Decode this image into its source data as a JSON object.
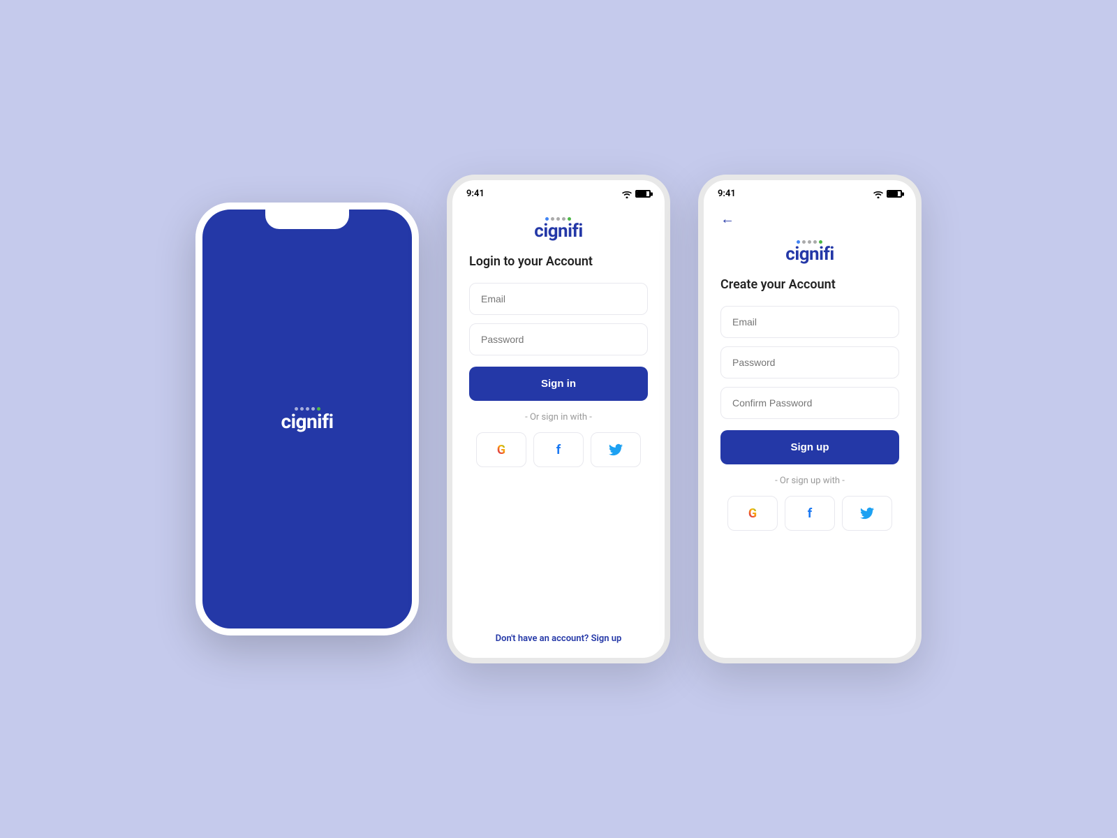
{
  "brand": {
    "name": "cignifi",
    "logo_dots_colors": [
      "#4285F4",
      "#888",
      "#888",
      "#888",
      "#34A853"
    ],
    "primary_color": "#2438a7"
  },
  "splash": {
    "logo_text": "cignifi"
  },
  "login_screen": {
    "status_time": "9:41",
    "title": "Login to your Account",
    "email_placeholder": "Email",
    "password_placeholder": "Password",
    "signin_button": "Sign in",
    "divider": "- Or sign in with -",
    "footer_text": "Don't have an account?",
    "footer_link": "Sign up"
  },
  "register_screen": {
    "status_time": "9:41",
    "back_icon": "←",
    "title": "Create your Account",
    "email_placeholder": "Email",
    "password_placeholder": "Password",
    "confirm_password_placeholder": "Confirm Password",
    "signup_button": "Sign up",
    "divider": "- Or sign up with -"
  },
  "social": {
    "google_label": "G",
    "facebook_label": "f",
    "twitter_label": "🐦"
  }
}
